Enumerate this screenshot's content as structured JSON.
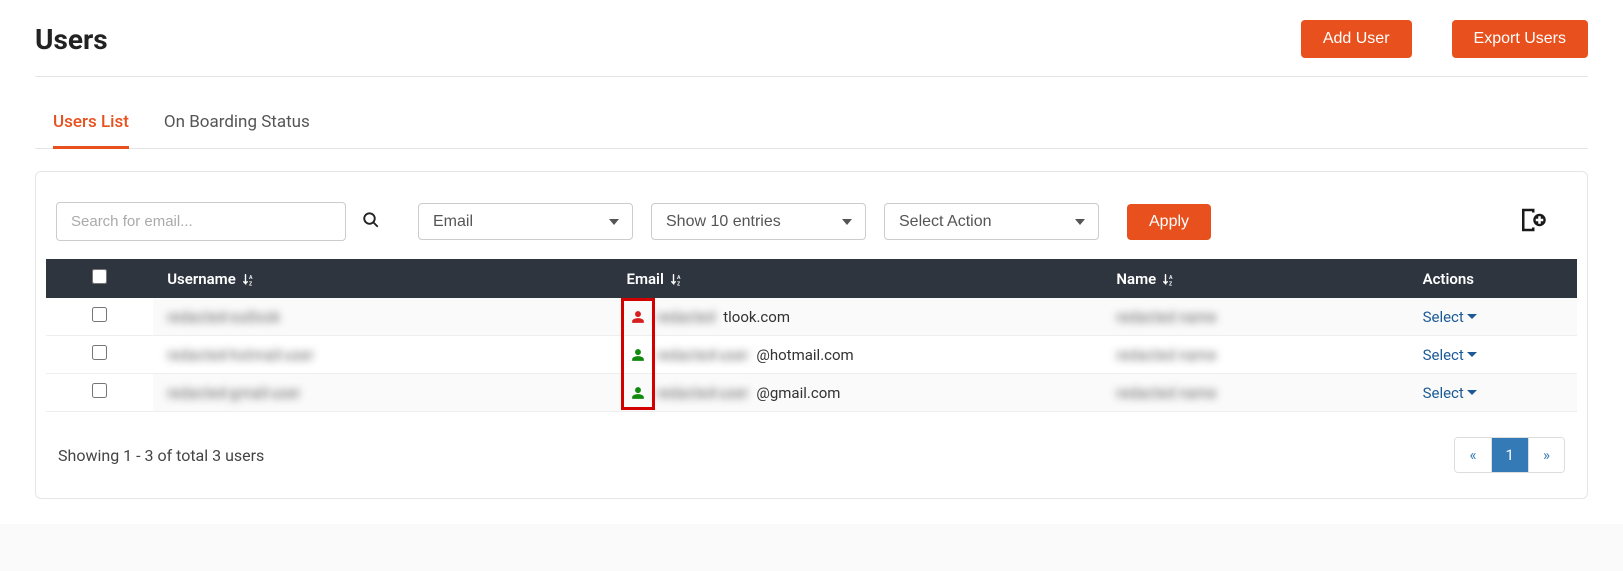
{
  "header": {
    "title": "Users",
    "add_button": "Add User",
    "export_button": "Export Users"
  },
  "tabs": [
    {
      "label": "Users List",
      "active": true
    },
    {
      "label": "On Boarding Status",
      "active": false
    }
  ],
  "filters": {
    "search_placeholder": "Search for email...",
    "select_field": "Email",
    "select_pagesize": "Show 10 entries",
    "select_action": "Select Action",
    "apply_label": "Apply"
  },
  "table": {
    "headers": {
      "username": "Username",
      "email": "Email",
      "name": "Name",
      "actions": "Actions"
    },
    "rows": [
      {
        "username": "redacted-outlook",
        "email_prefix": "redacted",
        "email_suffix": "tlook.com",
        "name": "redacted name",
        "status_color": "red",
        "action": "Select"
      },
      {
        "username": "redacted-hotmail-user",
        "email_prefix": "redacted-user",
        "email_suffix": "@hotmail.com",
        "name": "redacted name",
        "status_color": "green",
        "action": "Select"
      },
      {
        "username": "redacted-gmail-user",
        "email_prefix": "redacted-user",
        "email_suffix": "@gmail.com",
        "name": "redacted name",
        "status_color": "green",
        "action": "Select"
      }
    ]
  },
  "footer": {
    "showing": "Showing 1 - 3 of total 3 users",
    "prev": "«",
    "page": "1",
    "next": "»"
  }
}
